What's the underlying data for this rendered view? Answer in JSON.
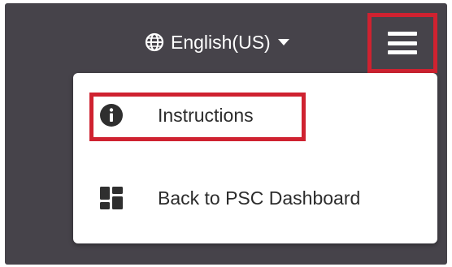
{
  "header": {
    "language_label": "English(US)",
    "language_icon": "globe-icon",
    "dropdown_icon": "caret-down-icon",
    "menu_icon": "hamburger-menu-icon"
  },
  "menu": {
    "items": [
      {
        "label": "Instructions",
        "icon": "info-icon"
      },
      {
        "label": "Back to PSC Dashboard",
        "icon": "dashboard-grid-icon"
      }
    ]
  },
  "colors": {
    "background": "#46434a",
    "highlight": "#cf2230",
    "menu_bg": "#ffffff",
    "text": "#2c2c2c"
  }
}
